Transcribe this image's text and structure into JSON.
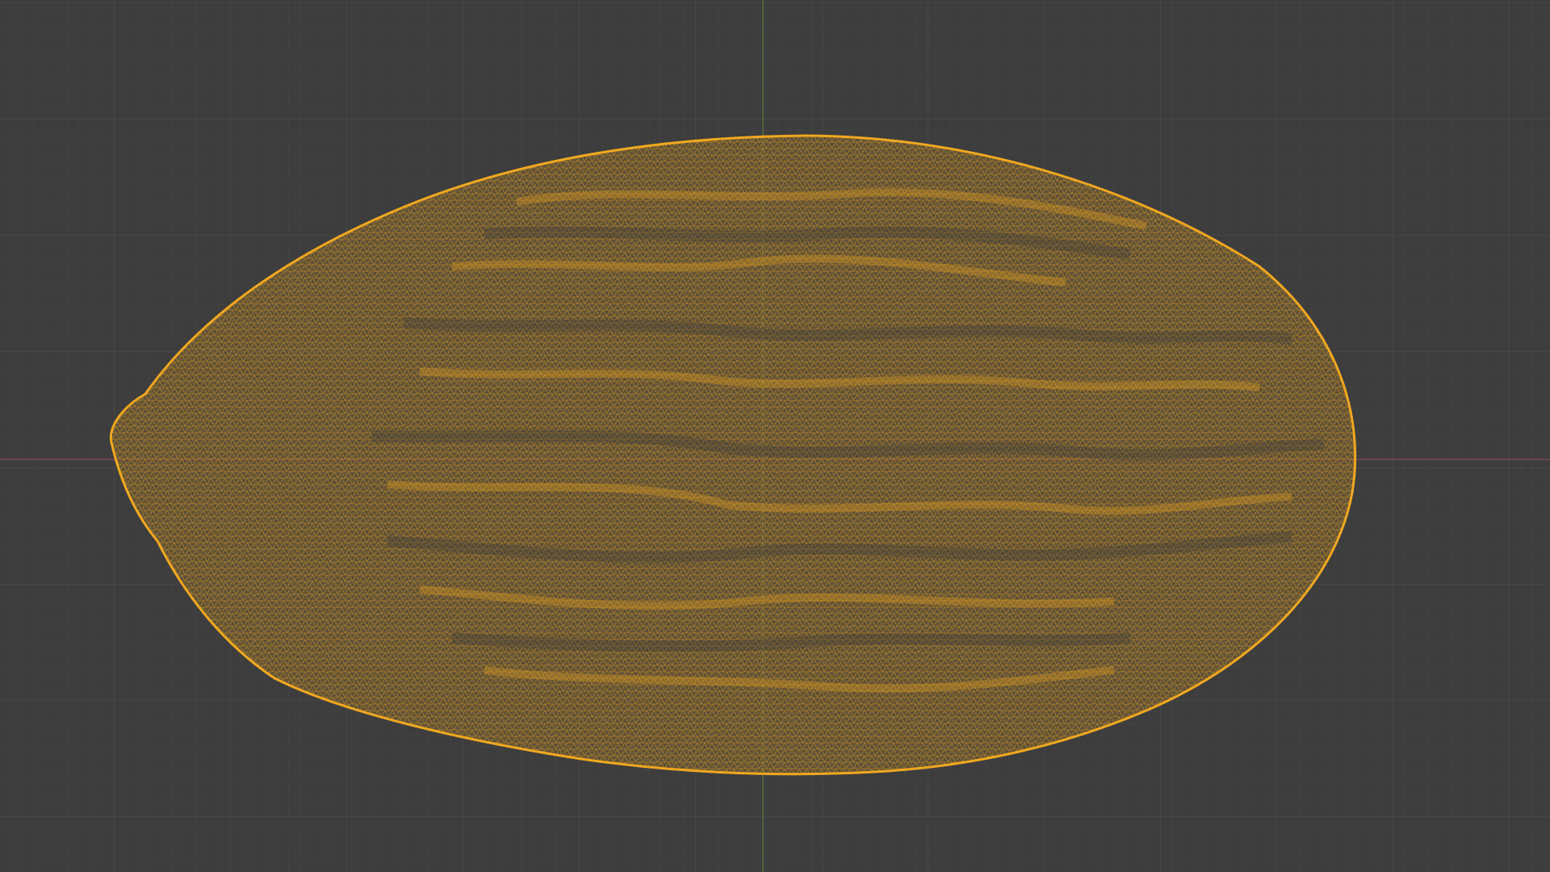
{
  "viewport": {
    "view": "top-orthographic",
    "shading": "wireframe",
    "background_color": "#3d3d3d",
    "grid": {
      "enabled": true,
      "minor_color": "#444444",
      "major_color": "#4a4a4a"
    },
    "axes": {
      "x_axis_color": "#7a4a52",
      "y_axis_color": "#5a7240"
    }
  },
  "object": {
    "type": "mesh",
    "shape": "almond",
    "selected": true,
    "wire_color": "#e39c1a",
    "outline_color": "#f0a820"
  }
}
